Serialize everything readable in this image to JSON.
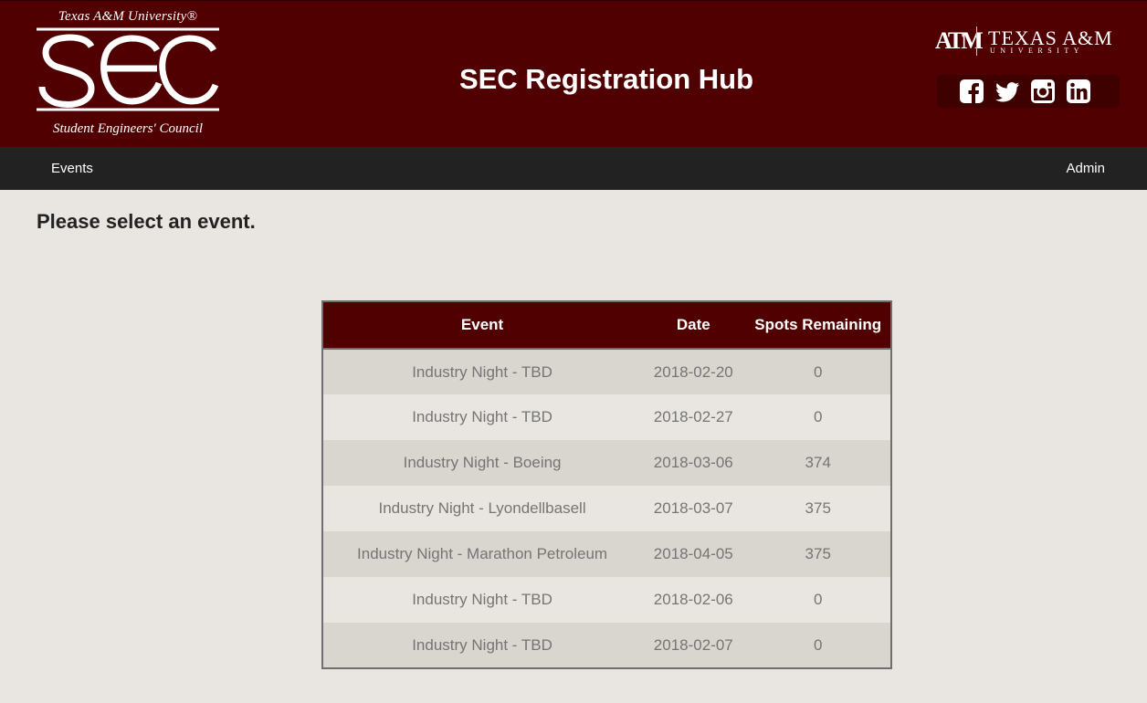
{
  "header": {
    "logo": {
      "university_text": "Texas A&M University®",
      "acronym": "SEC",
      "council_text": "Student Engineers' Council"
    },
    "title": "SEC Registration Hub",
    "brand": {
      "mark": "ATM",
      "name": "TEXAS A&M",
      "sub": "UNIVERSITY"
    },
    "social": [
      "facebook-icon",
      "twitter-icon",
      "instagram-icon",
      "linkedin-icon"
    ],
    "colors": {
      "maroon": "#500000",
      "nav": "#222222",
      "background": "#e9e6e1"
    }
  },
  "nav": {
    "events": "Events",
    "admin": "Admin"
  },
  "main": {
    "prompt": "Please select an event.",
    "table": {
      "headers": [
        "Event",
        "Date",
        "Spots Remaining"
      ],
      "rows": [
        [
          "Industry Night - TBD",
          "2018-02-20",
          "0"
        ],
        [
          "Industry Night - TBD",
          "2018-02-27",
          "0"
        ],
        [
          "Industry Night - Boeing",
          "2018-03-06",
          "374"
        ],
        [
          "Industry Night - Lyondellbasell",
          "2018-03-07",
          "375"
        ],
        [
          "Industry Night - Marathon Petroleum",
          "2018-04-05",
          "375"
        ],
        [
          "Industry Night - TBD",
          "2018-02-06",
          "0"
        ],
        [
          "Industry Night - TBD",
          "2018-02-07",
          "0"
        ]
      ]
    }
  }
}
